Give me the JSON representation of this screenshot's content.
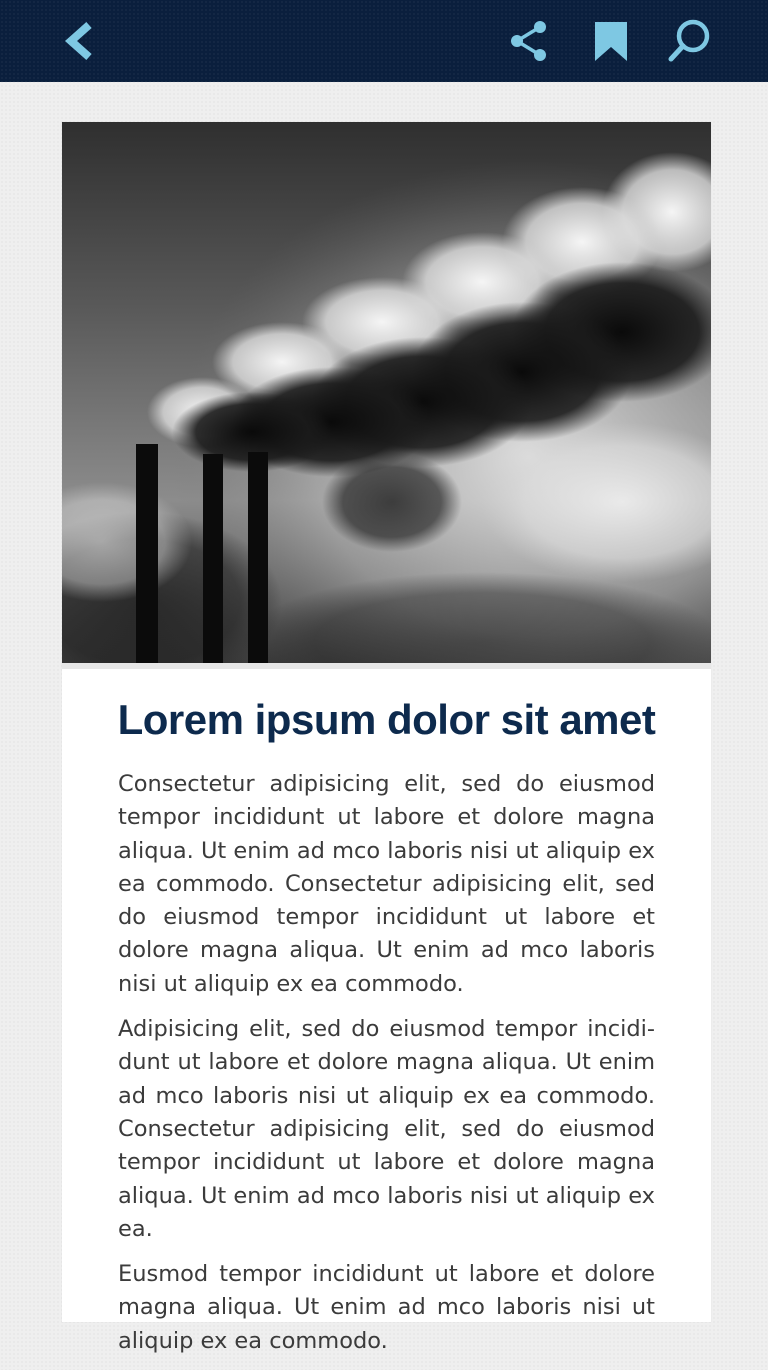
{
  "toolbar": {
    "back_icon": "chevron-left-icon",
    "share_icon": "share-icon",
    "bookmark_icon": "bookmark-icon",
    "search_icon": "search-icon",
    "icon_color": "#7ec8e3",
    "background": "#0a1f3d"
  },
  "article": {
    "image": "industrial-smokestacks-photo",
    "title": "Lorem ipsum dolor sit amet",
    "title_color": "#0d2a4d",
    "paragraphs": [
      "Consectetur adipisicing elit, sed do eiusmod tempor incididunt ut labore et dolore magna aliqua. Ut enim ad mco laboris nisi ut aliquip ex ea commodo. Consectetur adipisicing elit, sed do eiusmod tempor incididunt ut labore et dolore magna aliqua. Ut enim ad mco laboris nisi ut aliquip ex ea commodo.",
      "Adipisicing elit, sed do eiusmod tempor incidi­dunt ut labore et dolore magna aliqua. Ut enim ad mco laboris nisi ut aliquip ex ea commodo. Consectetur adipisicing elit, sed do eiusmod tempor incididunt ut labore et dolore magna aliqua. Ut enim ad mco laboris nisi ut aliquip ex ea.",
      "Eusmod tempor incididunt ut labore et dolore magna aliqua. Ut enim ad mco laboris nisi ut aliquip ex ea commodo."
    ]
  }
}
